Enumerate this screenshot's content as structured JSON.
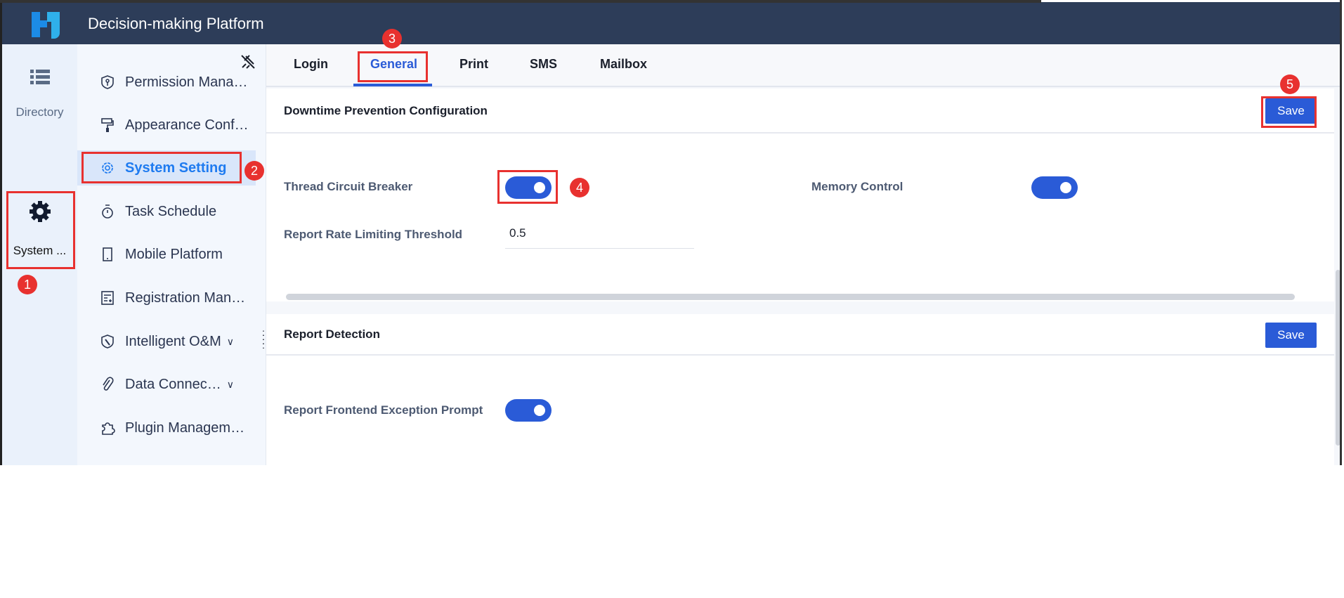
{
  "header": {
    "title": "Decision-making Platform"
  },
  "rail": {
    "items": [
      {
        "label": "Directory",
        "icon": "list-icon"
      },
      {
        "label": "System ...",
        "icon": "gear-icon"
      }
    ]
  },
  "submenu": {
    "items": [
      {
        "label": "Permission Mana…",
        "icon": "shield-key-icon"
      },
      {
        "label": "Appearance Conf…",
        "icon": "paint-roller-icon"
      },
      {
        "label": "System Setting",
        "icon": "gear-icon"
      },
      {
        "label": "Task Schedule",
        "icon": "stopwatch-icon"
      },
      {
        "label": "Mobile Platform",
        "icon": "mobile-icon"
      },
      {
        "label": "Registration Man…",
        "icon": "registration-icon"
      },
      {
        "label": "Intelligent O&M",
        "icon": "wrench-icon"
      },
      {
        "label": "Data Connec…",
        "icon": "paperclip-icon"
      },
      {
        "label": "Plugin Managem…",
        "icon": "puzzle-icon"
      }
    ]
  },
  "tabs": [
    "Login",
    "General",
    "Print",
    "SMS",
    "Mailbox"
  ],
  "sections": {
    "downtime": {
      "title": "Downtime Prevention Configuration",
      "save": "Save",
      "thread_label": "Thread Circuit Breaker",
      "thread_on": true,
      "memory_label": "Memory Control",
      "memory_on": true,
      "rate_label": "Report Rate Limiting Threshold",
      "rate_value": "0.5"
    },
    "detection": {
      "title": "Report Detection",
      "save": "Save",
      "prompt_label": "Report Frontend Exception Prompt",
      "prompt_on": true
    }
  },
  "annotations": [
    "1",
    "2",
    "3",
    "4",
    "5"
  ],
  "colors": {
    "header": "#2d3d59",
    "accent": "#2a5bd7",
    "annotation": "#e8312f",
    "active_menu": "#1f7bf0"
  }
}
